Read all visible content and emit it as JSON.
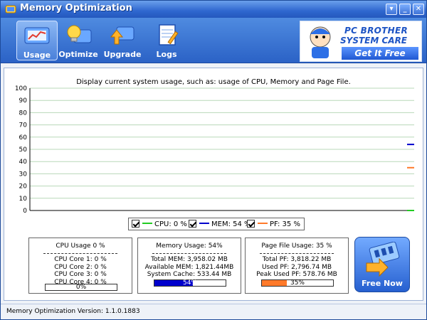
{
  "window": {
    "title": "Memory Optimization"
  },
  "toolbar": {
    "items": [
      {
        "label": "Usage"
      },
      {
        "label": "Optimize"
      },
      {
        "label": "Upgrade"
      },
      {
        "label": "Logs"
      }
    ]
  },
  "ad": {
    "line1": "PC BROTHER",
    "line2": "SYSTEM CARE",
    "cta": "Get It Free"
  },
  "main": {
    "caption": "Display current system usage, such as: usage of CPU, Memory and Page File."
  },
  "chart_data": {
    "type": "line",
    "ylim": [
      0,
      100
    ],
    "yticks": [
      "100",
      "90",
      "80",
      "70",
      "60",
      "50",
      "40",
      "30",
      "20",
      "10",
      "0"
    ],
    "grid": true,
    "series": [
      {
        "name": "CPU: 0 %",
        "value": 0,
        "color": "#22cc22"
      },
      {
        "name": "MEM: 54 %",
        "value": 54,
        "color": "#0000cc"
      },
      {
        "name": "PF: 35 %",
        "value": 35,
        "color": "#ff7a2a"
      }
    ]
  },
  "cpu_box": {
    "title": "CPU Usage 0 %",
    "core1": "CPU Core 1: 0 %",
    "core2": "CPU Core 2: 0 %",
    "core3": "CPU Core 3: 0 %",
    "core4": "CPU Core 4: 0 %",
    "bar_label": "0%",
    "bar_value": 0
  },
  "mem_box": {
    "title": "Memory Usage: 54%",
    "total": "Total MEM: 3,958.02 MB",
    "available": "Available MEM: 1,821.44MB",
    "cache": "System Cache: 533.44 MB",
    "bar_label": "54%",
    "bar_value": 54,
    "bar_color": "#0000cc"
  },
  "pf_box": {
    "title": "Page File Usage: 35 %",
    "total": "Total PF: 3,818.22 MB",
    "used": "Used PF: 2,796.74 MB",
    "peak": "Peak Used PF: 578.76 MB",
    "bar_label": "35%",
    "bar_value": 35,
    "bar_color": "#ff7a2a"
  },
  "free_now": {
    "label": "Free Now"
  },
  "status": {
    "version": "Memory Optimization Version: 1.1.0.1883"
  }
}
